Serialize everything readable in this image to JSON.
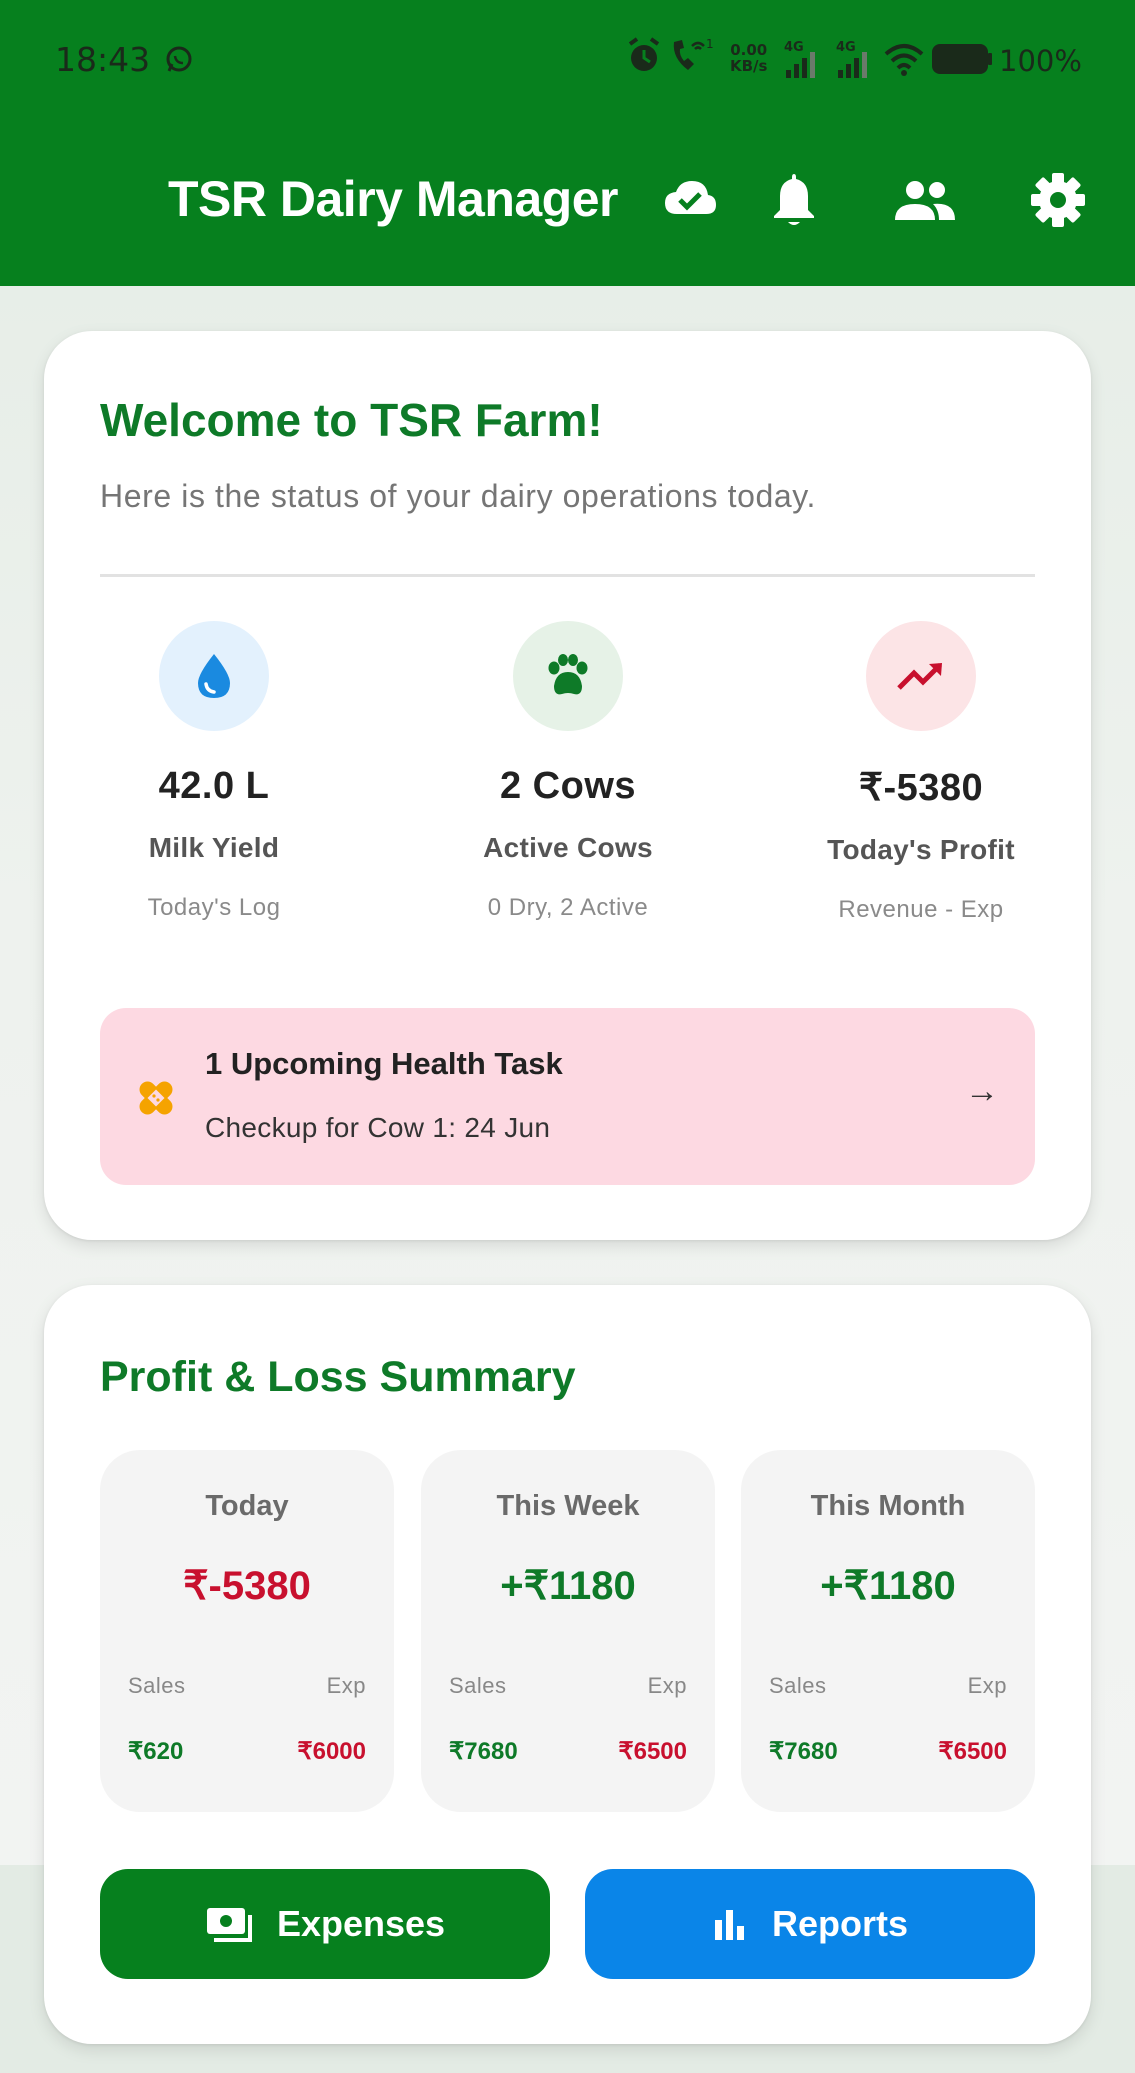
{
  "status_bar": {
    "time": "18:43",
    "net_speed_value": "0.00",
    "net_speed_unit": "KB/s",
    "network_1": "4G",
    "network_2": "4G",
    "battery": "100%"
  },
  "header": {
    "title": "TSR Dairy Manager",
    "bg_color": "#06801e"
  },
  "welcome": {
    "title": "Welcome to TSR Farm!",
    "subtitle": "Here is the status of your dairy operations today.",
    "stats": [
      {
        "icon": "drop-icon",
        "value": "42.0 L",
        "label": "Milk Yield",
        "sub": "Today's Log"
      },
      {
        "icon": "paw-icon",
        "value": "2 Cows",
        "label": "Active Cows",
        "sub": "0 Dry, 2 Active"
      },
      {
        "icon": "trending-up-icon",
        "value": "₹-5380",
        "label": "Today's Profit",
        "sub": "Revenue - Exp"
      }
    ],
    "health_task": {
      "icon": "bandage-icon",
      "title": "1 Upcoming Health Task",
      "detail": "Checkup for Cow 1: 24 Jun",
      "arrow": "→"
    }
  },
  "profit_loss": {
    "title": "Profit & Loss Summary",
    "periods": [
      {
        "name": "Today",
        "net": "₹-5380",
        "sales_label": "Sales",
        "exp_label": "Exp",
        "sales": "₹620",
        "exp": "₹6000"
      },
      {
        "name": "This Week",
        "net": "+₹1180",
        "sales_label": "Sales",
        "exp_label": "Exp",
        "sales": "₹7680",
        "exp": "₹6500"
      },
      {
        "name": "This Month",
        "net": "+₹1180",
        "sales_label": "Sales",
        "exp_label": "Exp",
        "sales": "₹7680",
        "exp": "₹6500"
      }
    ]
  },
  "actions": {
    "expenses_label": "Expenses",
    "reports_label": "Reports"
  },
  "colors": {
    "primary_green": "#06801e",
    "accent_blue": "#0a85e8",
    "negative_red": "#c8102e",
    "health_banner": "#fdd9e2"
  }
}
